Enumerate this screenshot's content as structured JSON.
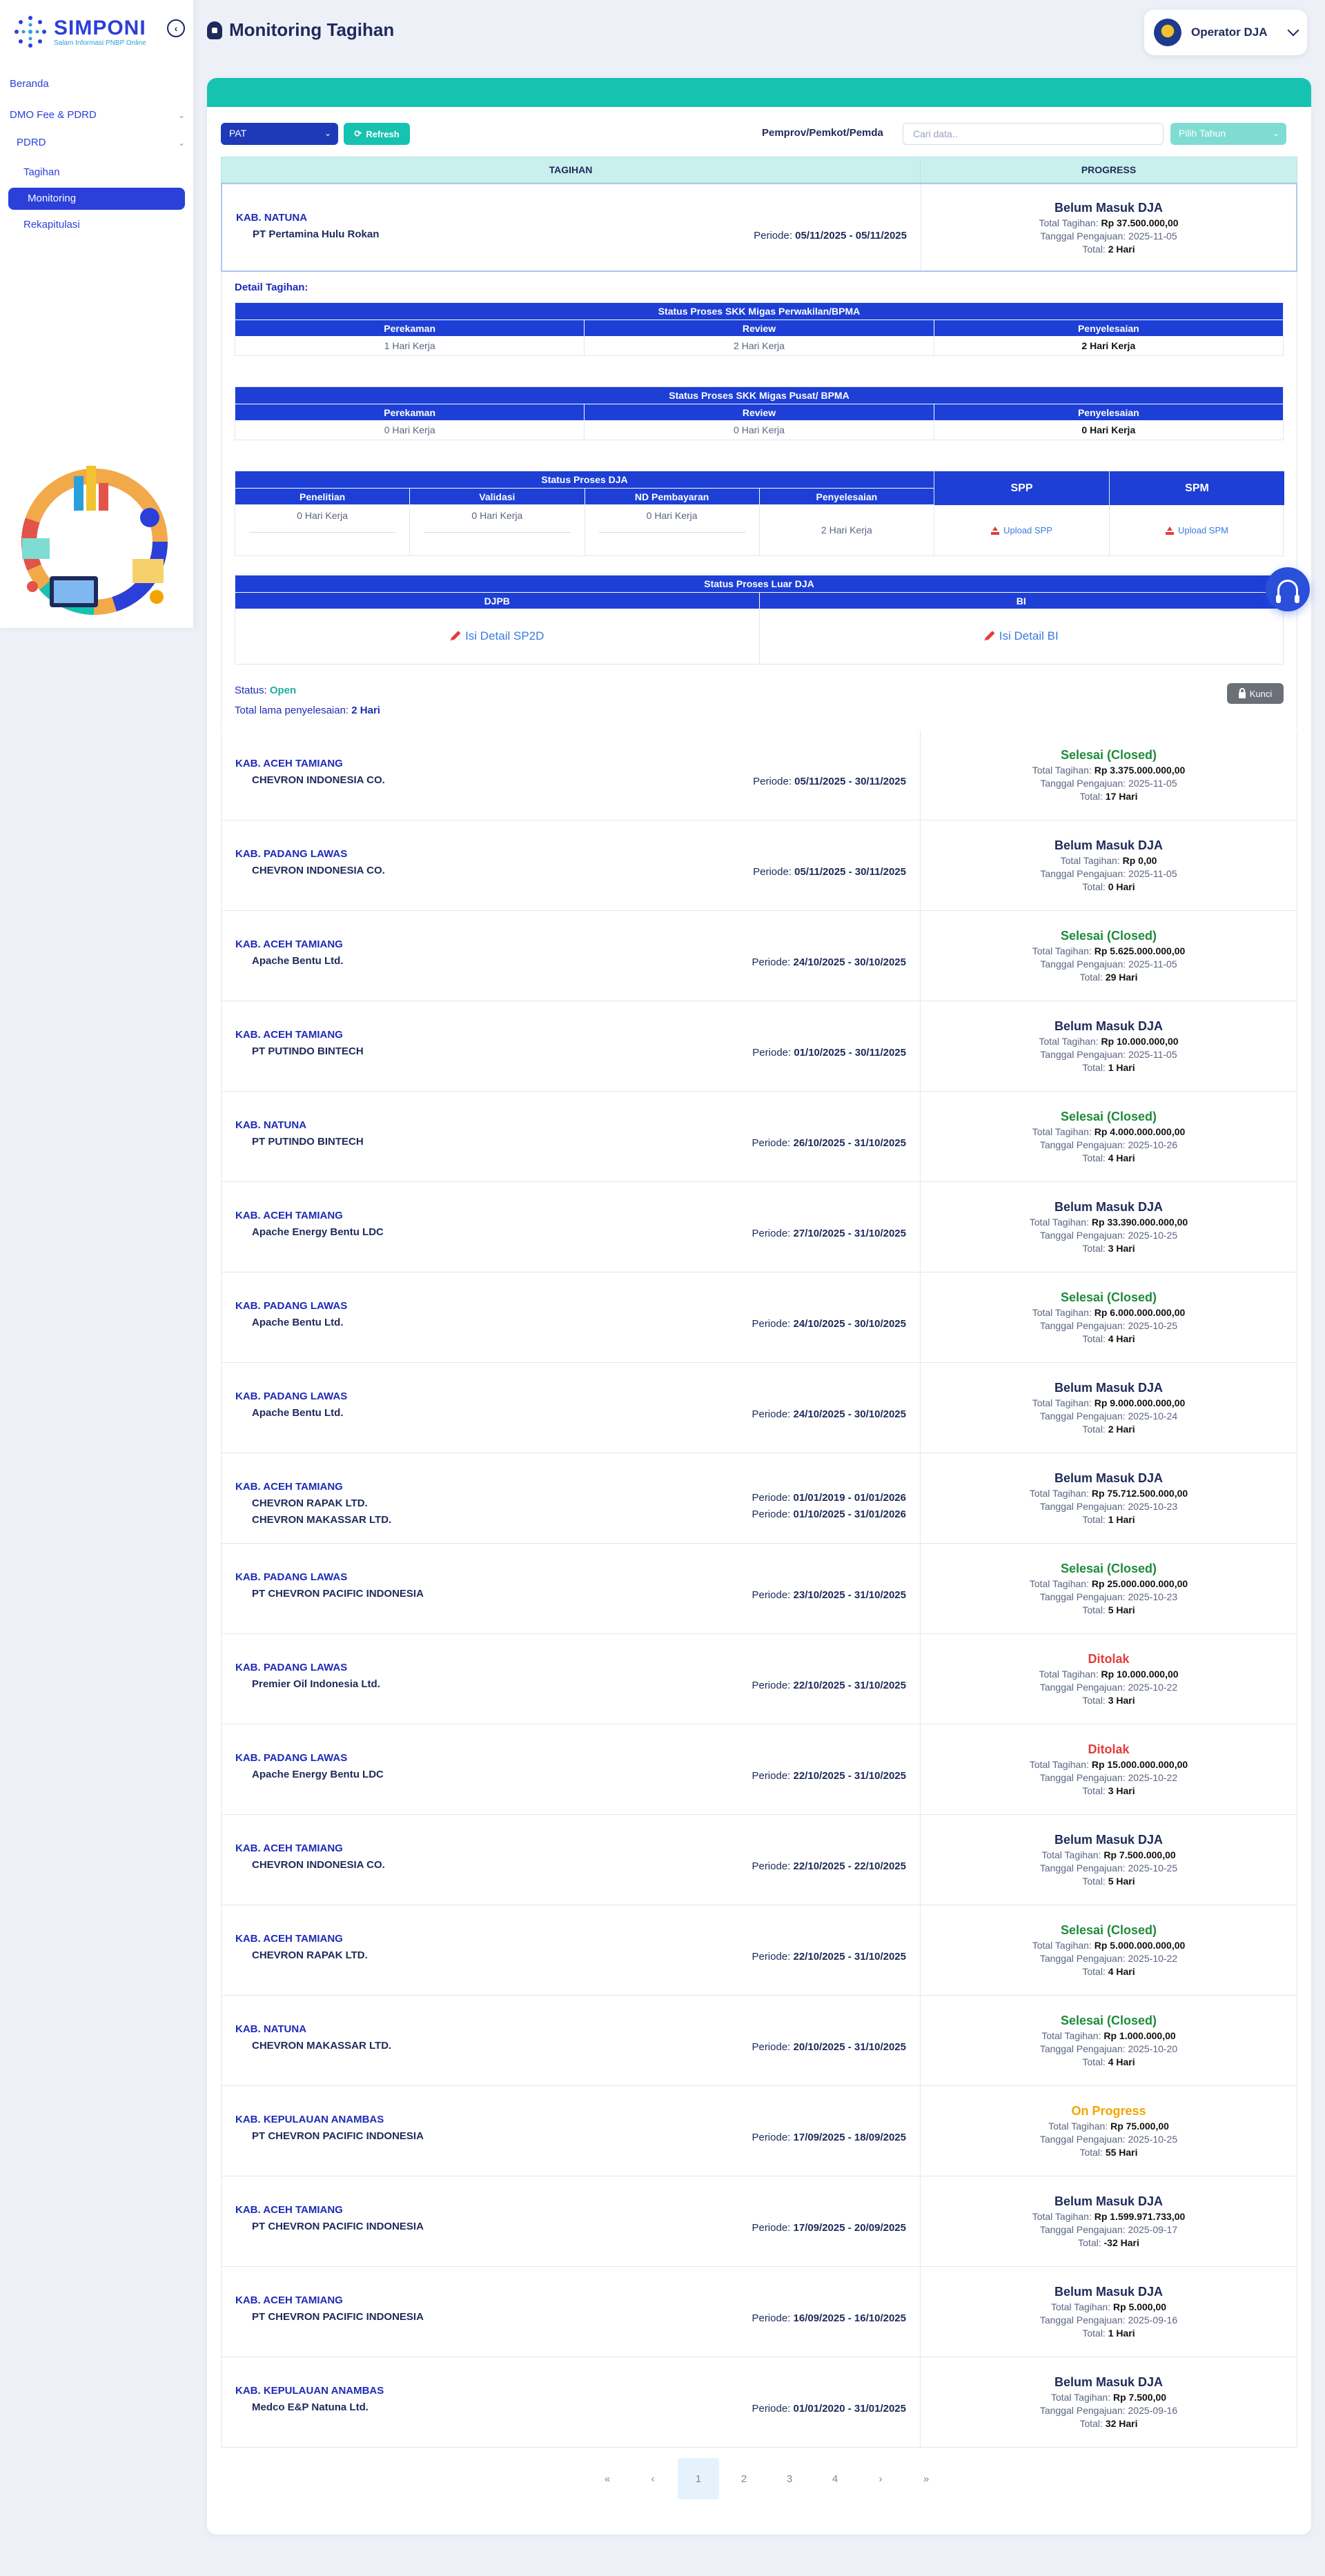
{
  "app": {
    "logo_title": "SIMPONI",
    "logo_subtitle": "Salam Informasi PNBP Online",
    "page_title": "Monitoring Tagihan",
    "user_name": "Operator DJA"
  },
  "sidebar": {
    "beranda": "Beranda",
    "dmo": "DMO Fee & PDRD",
    "pdrd": "PDRD",
    "tagihan": "Tagihan",
    "monitoring": "Monitoring",
    "rekapitulasi": "Rekapitulasi"
  },
  "filters": {
    "type_value": "PAT",
    "refresh_label": "Refresh",
    "pemda_label": "Pemprov/Pemkot/Pemda",
    "search_placeholder": "Cari data..",
    "year_placeholder": "Pilih Tahun"
  },
  "table": {
    "col_tagihan": "TAGIHAN",
    "col_progress": "PROGRESS",
    "periode_label": "Periode:",
    "total_tagihan_label": "Total Tagihan:",
    "tanggal_label": "Tanggal Pengajuan:",
    "total_label": "Total:"
  },
  "expanded_row": {
    "kab": "KAB. NATUNA",
    "company": "PT Pertamina Hulu Rokan",
    "periode": "05/11/2025 - 05/11/2025",
    "status": "Belum Masuk DJA",
    "total_tagihan": "Rp 37.500.000,00",
    "tanggal": "2025-11-05",
    "total": "2 Hari"
  },
  "detail": {
    "label": "Detail Tagihan:",
    "perwakilan": {
      "title": "Status Proses SKK Migas Perwakilan/BPMA",
      "headers": [
        "Perekaman",
        "Review",
        "Penyelesaian"
      ],
      "values": [
        "1 Hari Kerja",
        "2 Hari Kerja",
        "2 Hari Kerja"
      ]
    },
    "pusat": {
      "title": "Status Proses SKK Migas Pusat/ BPMA",
      "headers": [
        "Perekaman",
        "Review",
        "Penyelesaian"
      ],
      "values": [
        "0 Hari Kerja",
        "0 Hari Kerja",
        "0 Hari Kerja"
      ]
    },
    "dja": {
      "title": "Status Proses DJA",
      "headers": [
        "Penelitian",
        "Validasi",
        "ND Pembayaran",
        "Penyelesaian"
      ],
      "values": [
        "0 Hari Kerja",
        "0 Hari Kerja",
        "0 Hari Kerja",
        "2 Hari Kerja"
      ],
      "spp_header": "SPP",
      "spm_header": "SPM",
      "upload_spp": "Upload SPP",
      "upload_spm": "Upload SPM"
    },
    "luar": {
      "title": "Status Proses Luar DJA",
      "headers": [
        "DJPB",
        "BI"
      ],
      "isi_sp2d": "Isi Detail SP2D",
      "isi_bi": "Isi Detail BI"
    },
    "status_label": "Status:",
    "status_value": "Open",
    "total_lama_label": "Total lama penyelesaian:",
    "total_lama_value": "2 Hari",
    "kunci_label": "Kunci"
  },
  "rows": [
    {
      "kab": "KAB. ACEH TAMIANG",
      "companies": [
        "CHEVRON INDONESIA CO."
      ],
      "periodes": [
        "05/11/2025 - 30/11/2025"
      ],
      "status": "Selesai (Closed)",
      "status_color": "green",
      "total_tagihan": "Rp 3.375.000.000,00",
      "tanggal": "2025-11-05",
      "total": "17 Hari"
    },
    {
      "kab": "KAB. PADANG LAWAS",
      "companies": [
        "CHEVRON INDONESIA CO."
      ],
      "periodes": [
        "05/11/2025 - 30/11/2025"
      ],
      "status": "Belum Masuk DJA",
      "status_color": "blue",
      "total_tagihan": "Rp 0,00",
      "tanggal": "2025-11-05",
      "total": "0 Hari"
    },
    {
      "kab": "KAB. ACEH TAMIANG",
      "companies": [
        "Apache Bentu Ltd."
      ],
      "periodes": [
        "24/10/2025 - 30/10/2025"
      ],
      "status": "Selesai (Closed)",
      "status_color": "green",
      "total_tagihan": "Rp 5.625.000.000,00",
      "tanggal": "2025-11-05",
      "total": "29 Hari"
    },
    {
      "kab": "KAB. ACEH TAMIANG",
      "companies": [
        "PT PUTINDO BINTECH"
      ],
      "periodes": [
        "01/10/2025 - 30/11/2025"
      ],
      "status": "Belum Masuk DJA",
      "status_color": "blue",
      "total_tagihan": "Rp 10.000.000,00",
      "tanggal": "2025-11-05",
      "total": "1 Hari"
    },
    {
      "kab": "KAB. NATUNA",
      "companies": [
        "PT PUTINDO BINTECH"
      ],
      "periodes": [
        "26/10/2025 - 31/10/2025"
      ],
      "status": "Selesai (Closed)",
      "status_color": "green",
      "total_tagihan": "Rp 4.000.000.000,00",
      "tanggal": "2025-10-26",
      "total": "4 Hari"
    },
    {
      "kab": "KAB. ACEH TAMIANG",
      "companies": [
        "Apache Energy Bentu LDC"
      ],
      "periodes": [
        "27/10/2025 - 31/10/2025"
      ],
      "status": "Belum Masuk DJA",
      "status_color": "blue",
      "total_tagihan": "Rp 33.390.000.000,00",
      "tanggal": "2025-10-25",
      "total": "3 Hari"
    },
    {
      "kab": "KAB. PADANG LAWAS",
      "companies": [
        "Apache Bentu Ltd."
      ],
      "periodes": [
        "24/10/2025 - 30/10/2025"
      ],
      "status": "Selesai (Closed)",
      "status_color": "green",
      "total_tagihan": "Rp 6.000.000.000,00",
      "tanggal": "2025-10-25",
      "total": "4 Hari"
    },
    {
      "kab": "KAB. PADANG LAWAS",
      "companies": [
        "Apache Bentu Ltd."
      ],
      "periodes": [
        "24/10/2025 - 30/10/2025"
      ],
      "status": "Belum Masuk DJA",
      "status_color": "blue",
      "total_tagihan": "Rp 9.000.000.000,00",
      "tanggal": "2025-10-24",
      "total": "2 Hari"
    },
    {
      "kab": "KAB. ACEH TAMIANG",
      "companies": [
        "CHEVRON RAPAK LTD.",
        "CHEVRON MAKASSAR LTD."
      ],
      "periodes": [
        "01/01/2019 - 01/01/2026",
        "01/10/2025 - 31/01/2026"
      ],
      "status": "Belum Masuk DJA",
      "status_color": "blue",
      "total_tagihan": "Rp 75.712.500.000,00",
      "tanggal": "2025-10-23",
      "total": "1 Hari"
    },
    {
      "kab": "KAB. PADANG LAWAS",
      "companies": [
        "PT CHEVRON PACIFIC INDONESIA"
      ],
      "periodes": [
        "23/10/2025 - 31/10/2025"
      ],
      "status": "Selesai (Closed)",
      "status_color": "green",
      "total_tagihan": "Rp 25.000.000.000,00",
      "tanggal": "2025-10-23",
      "total": "5 Hari"
    },
    {
      "kab": "KAB. PADANG LAWAS",
      "companies": [
        "Premier Oil Indonesia Ltd."
      ],
      "periodes": [
        "22/10/2025 - 31/10/2025"
      ],
      "status": "Ditolak",
      "status_color": "red",
      "total_tagihan": "Rp 10.000.000,00",
      "tanggal": "2025-10-22",
      "total": "3 Hari"
    },
    {
      "kab": "KAB. PADANG LAWAS",
      "companies": [
        "Apache Energy Bentu LDC"
      ],
      "periodes": [
        "22/10/2025 - 31/10/2025"
      ],
      "status": "Ditolak",
      "status_color": "red",
      "total_tagihan": "Rp 15.000.000.000,00",
      "tanggal": "2025-10-22",
      "total": "3 Hari"
    },
    {
      "kab": "KAB. ACEH TAMIANG",
      "companies": [
        "CHEVRON INDONESIA CO."
      ],
      "periodes": [
        "22/10/2025 - 22/10/2025"
      ],
      "status": "Belum Masuk DJA",
      "status_color": "blue",
      "total_tagihan": "Rp 7.500.000,00",
      "tanggal": "2025-10-25",
      "total": "5 Hari"
    },
    {
      "kab": "KAB. ACEH TAMIANG",
      "companies": [
        "CHEVRON RAPAK LTD."
      ],
      "periodes": [
        "22/10/2025 - 31/10/2025"
      ],
      "status": "Selesai (Closed)",
      "status_color": "green",
      "total_tagihan": "Rp 5.000.000.000,00",
      "tanggal": "2025-10-22",
      "total": "4 Hari"
    },
    {
      "kab": "KAB. NATUNA",
      "companies": [
        "CHEVRON MAKASSAR LTD."
      ],
      "periodes": [
        "20/10/2025 - 31/10/2025"
      ],
      "status": "Selesai (Closed)",
      "status_color": "green",
      "total_tagihan": "Rp 1.000.000,00",
      "tanggal": "2025-10-20",
      "total": "4 Hari"
    },
    {
      "kab": "KAB. KEPULAUAN ANAMBAS",
      "companies": [
        "PT CHEVRON PACIFIC INDONESIA"
      ],
      "periodes": [
        "17/09/2025 - 18/09/2025"
      ],
      "status": "On Progress",
      "status_color": "orange",
      "total_tagihan": "Rp 75.000,00",
      "tanggal": "2025-10-25",
      "total": "55 Hari"
    },
    {
      "kab": "KAB. ACEH TAMIANG",
      "companies": [
        "PT CHEVRON PACIFIC INDONESIA"
      ],
      "periodes": [
        "17/09/2025 - 20/09/2025"
      ],
      "status": "Belum Masuk DJA",
      "status_color": "blue",
      "total_tagihan": "Rp 1.599.971.733,00",
      "tanggal": "2025-09-17",
      "total": "-32 Hari"
    },
    {
      "kab": "KAB. ACEH TAMIANG",
      "companies": [
        "PT CHEVRON PACIFIC INDONESIA"
      ],
      "periodes": [
        "16/09/2025 - 16/10/2025"
      ],
      "status": "Belum Masuk DJA",
      "status_color": "blue",
      "total_tagihan": "Rp 5.000,00",
      "tanggal": "2025-09-16",
      "total": "1 Hari"
    },
    {
      "kab": "KAB. KEPULAUAN ANAMBAS",
      "companies": [
        "Medco E&P Natuna Ltd."
      ],
      "periodes": [
        "01/01/2020 - 31/01/2025"
      ],
      "status": "Belum Masuk DJA",
      "status_color": "blue",
      "total_tagihan": "Rp 7.500,00",
      "tanggal": "2025-09-16",
      "total": "32 Hari"
    }
  ],
  "pagination": {
    "first": "«",
    "prev": "‹",
    "pages": [
      "1",
      "2",
      "3",
      "4"
    ],
    "active": "1",
    "next": "›",
    "last": "»"
  }
}
